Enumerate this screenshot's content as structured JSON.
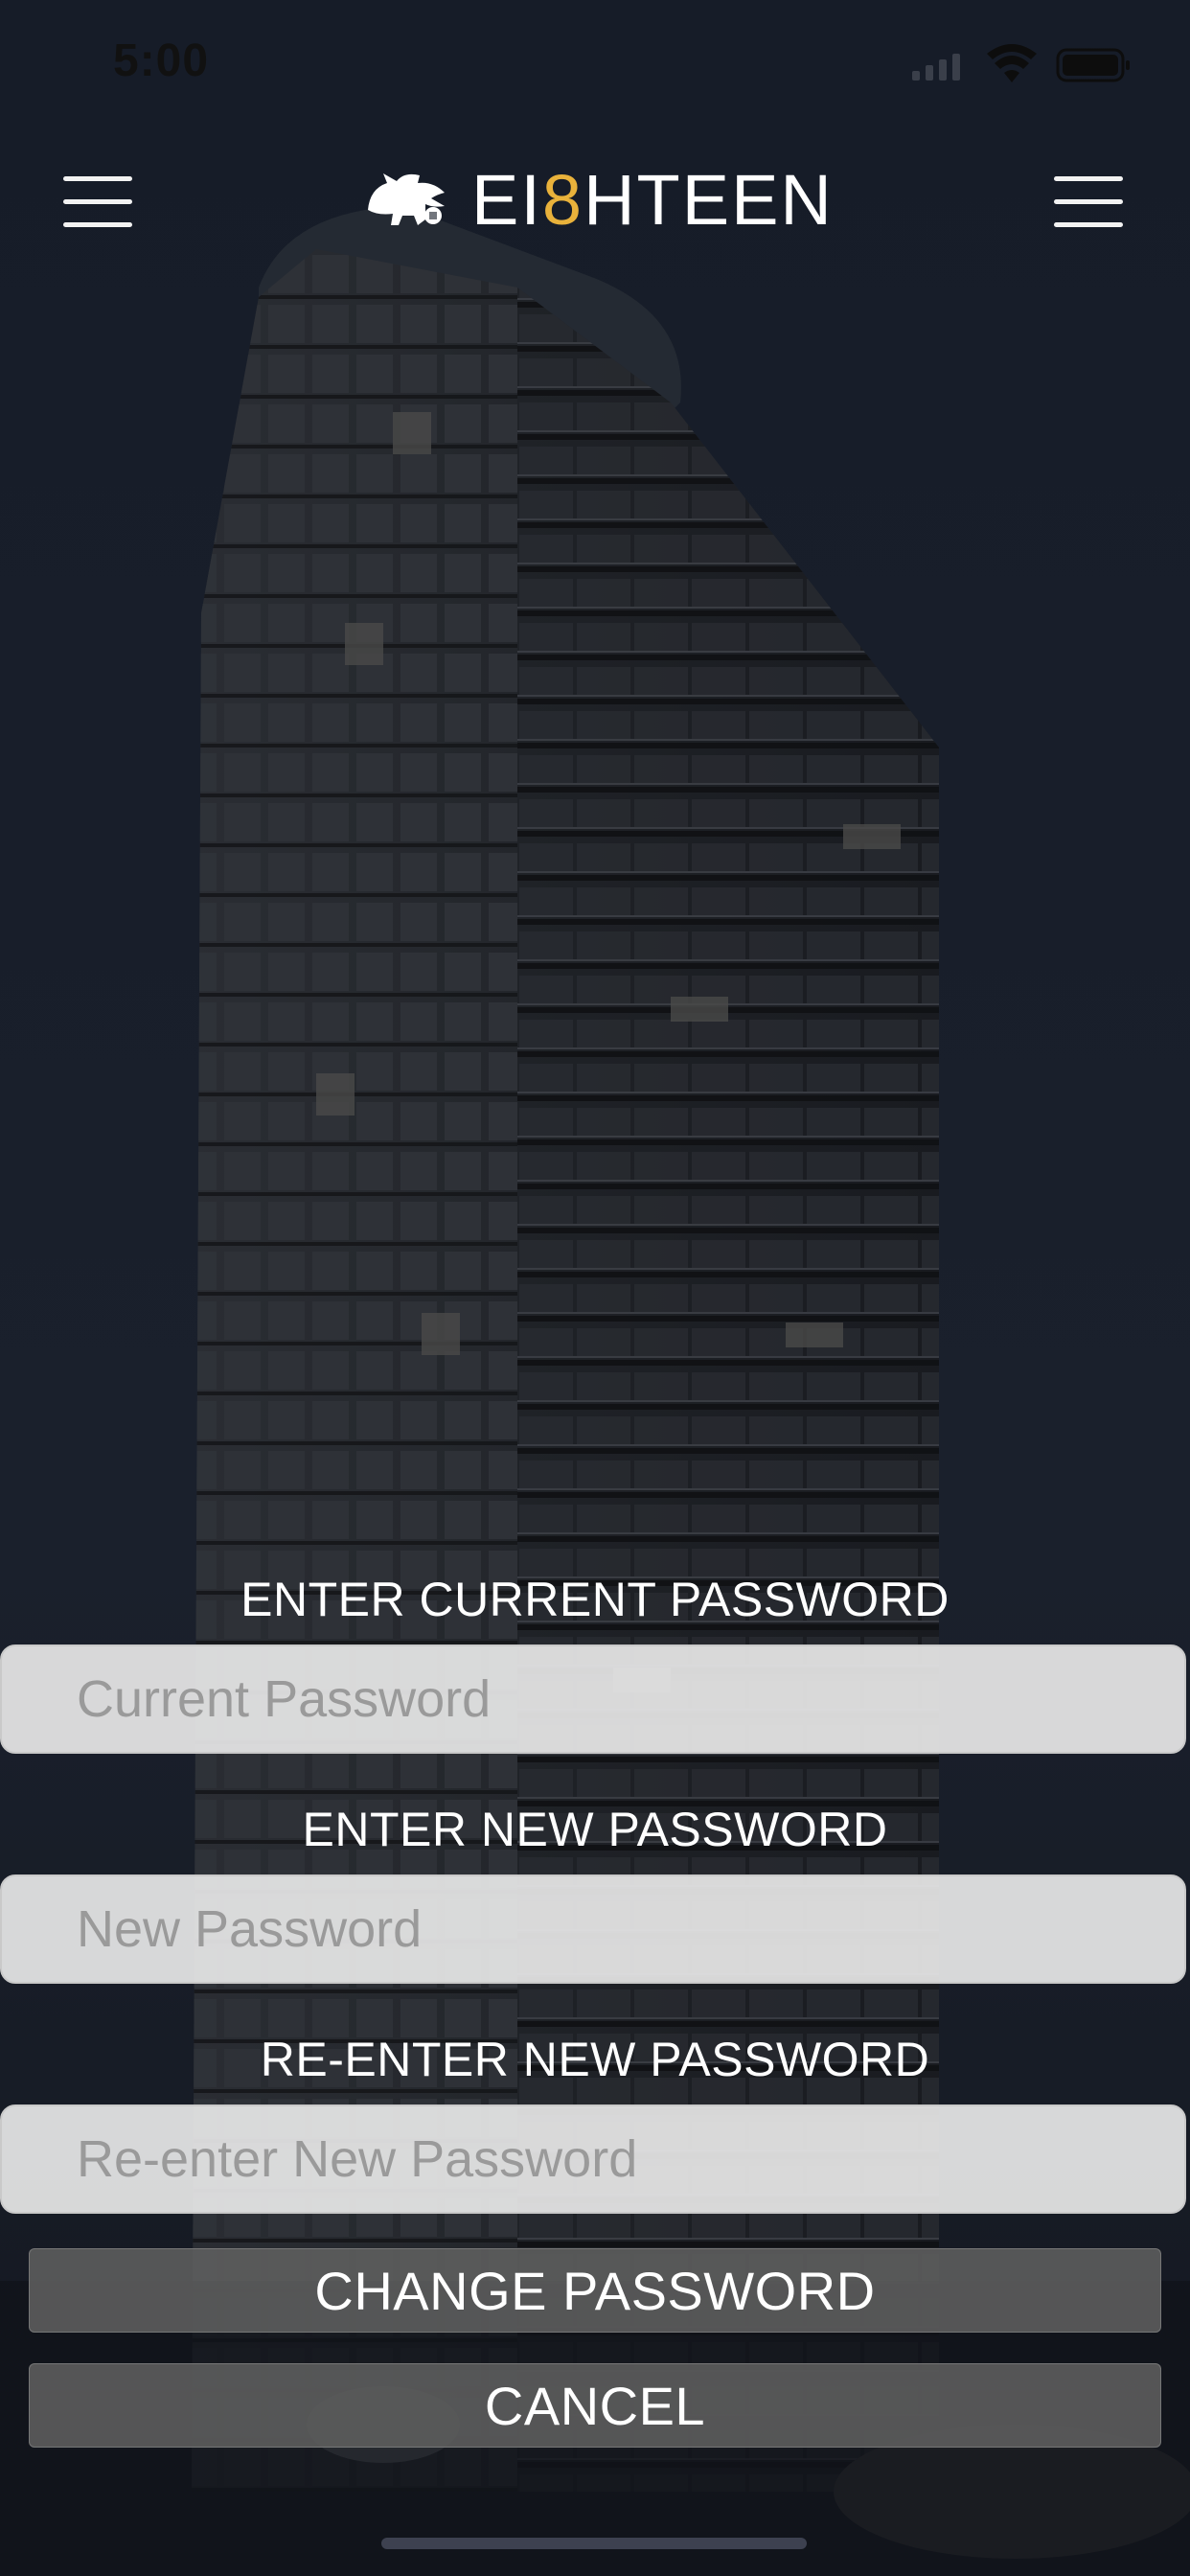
{
  "status_bar": {
    "time": "5:00",
    "icons": [
      "signal-icon",
      "wifi-icon",
      "battery-icon"
    ]
  },
  "header": {
    "brand": {
      "prefix": "EI",
      "accent": "8",
      "suffix": "HTEEN",
      "accent_color": "#e9b23b"
    },
    "left_menu_icon": "hamburger-menu-icon",
    "right_menu_icon": "hamburger-menu-icon"
  },
  "form": {
    "current": {
      "label": "ENTER CURRENT PASSWORD",
      "placeholder": "Current Password",
      "value": ""
    },
    "new": {
      "label": "ENTER NEW PASSWORD",
      "placeholder": "New Password",
      "value": ""
    },
    "confirm": {
      "label": "RE-ENTER NEW PASSWORD",
      "placeholder": "Re-enter New Password",
      "value": ""
    },
    "change_button": "CHANGE PASSWORD",
    "cancel_button": "CANCEL"
  },
  "colors": {
    "background": "#141a26",
    "accent": "#e9b23b",
    "field_bg": "#e8e8e8",
    "button_bg": "#5f5f5f"
  }
}
